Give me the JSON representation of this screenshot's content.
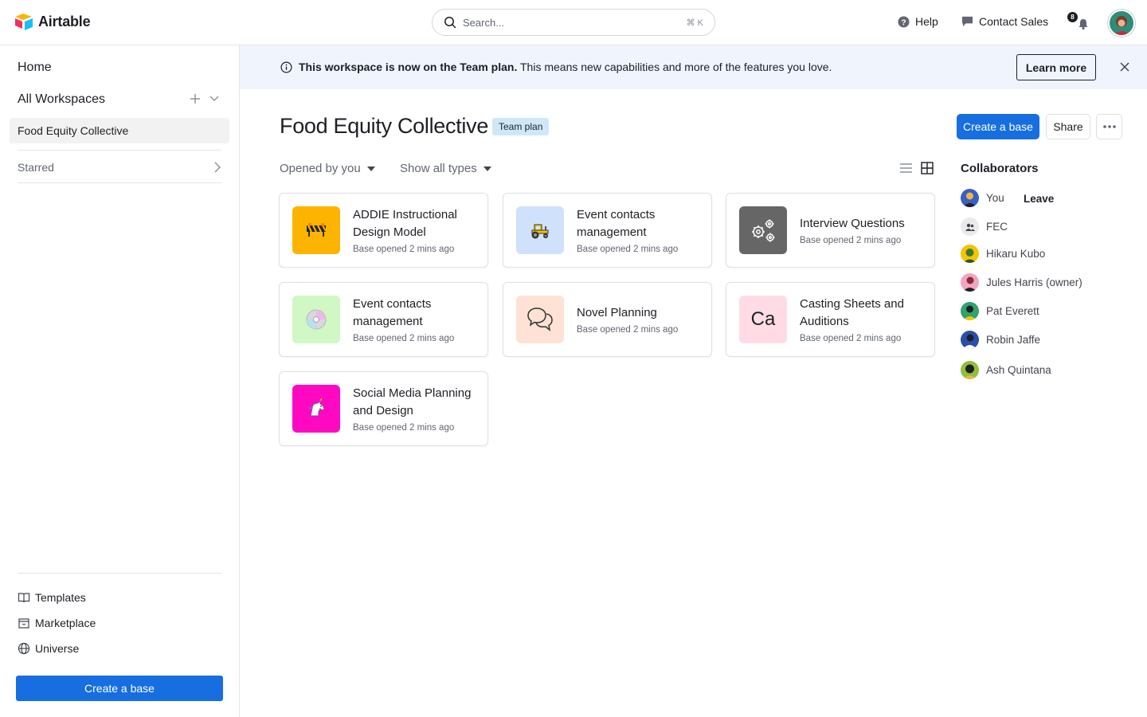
{
  "app": {
    "name": "Airtable"
  },
  "search": {
    "placeholder": "Search...",
    "shortcut": "⌘ K"
  },
  "topnav": {
    "help": "Help",
    "contact": "Contact Sales",
    "notification_count": "8"
  },
  "sidebar": {
    "home": "Home",
    "all_workspaces": "All Workspaces",
    "workspace": "Food Equity Collective",
    "starred": "Starred",
    "links": [
      {
        "label": "Templates",
        "icon": "book-icon"
      },
      {
        "label": "Marketplace",
        "icon": "store-icon"
      },
      {
        "label": "Universe",
        "icon": "globe-icon"
      }
    ],
    "create_button": "Create a base"
  },
  "banner": {
    "bold": "This workspace is now on the Team plan.",
    "text": " This means new capabilities and more of the features you love.",
    "button": "Learn more"
  },
  "workspace": {
    "title": "Food Equity Collective",
    "badge": "Team plan",
    "create_button": "Create a base",
    "share_button": "Share"
  },
  "filters": {
    "opened": "Opened by you",
    "types": "Show all types"
  },
  "bases": [
    {
      "title": "ADDIE Instructional Design Model",
      "subtitle": "Base opened 2 mins ago",
      "icon": "construction-icon",
      "color": "#fcb400"
    },
    {
      "title": "Event contacts management",
      "subtitle": "Base opened 2 mins ago",
      "icon": "tractor-icon",
      "color": "#d0e1fc"
    },
    {
      "title": "Interview Questions",
      "subtitle": "Base opened 2 mins ago",
      "icon": "gears-icon",
      "color": "#666666"
    },
    {
      "title": "Event contacts management",
      "subtitle": "Base opened 2 mins ago",
      "icon": "disc-icon",
      "color": "#d1f7c4"
    },
    {
      "title": "Novel Planning",
      "subtitle": "Base opened 2 mins ago",
      "icon": "chat-bubbles-icon",
      "color": "#fee2d5"
    },
    {
      "title": "Casting Sheets and Auditions",
      "subtitle": "Base opened 2 mins ago",
      "icon": "initials-icon",
      "initials": "Ca",
      "color": "#ffdce5"
    },
    {
      "title": "Social Media Planning and Design",
      "subtitle": "Base opened 2 mins ago",
      "icon": "unicorn-icon",
      "color": "#ff08c2"
    }
  ],
  "collaborators": {
    "heading": "Collaborators",
    "leave": "Leave",
    "people": [
      {
        "name": "You"
      },
      {
        "name": "FEC"
      },
      {
        "name": "Hikaru Kubo"
      },
      {
        "name": "Jules Harris (owner)"
      },
      {
        "name": "Pat Everett"
      },
      {
        "name": "Robin Jaffe"
      },
      {
        "name": "Ash Quintana"
      }
    ]
  }
}
